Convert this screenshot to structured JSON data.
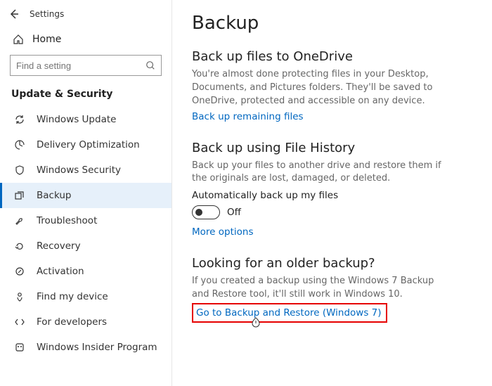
{
  "app": {
    "title": "Settings"
  },
  "home": {
    "label": "Home"
  },
  "search": {
    "placeholder": "Find a setting"
  },
  "section_header": "Update & Security",
  "nav": [
    {
      "key": "windows-update",
      "label": "Windows Update"
    },
    {
      "key": "delivery-optimization",
      "label": "Delivery Optimization"
    },
    {
      "key": "windows-security",
      "label": "Windows Security"
    },
    {
      "key": "backup",
      "label": "Backup",
      "selected": true
    },
    {
      "key": "troubleshoot",
      "label": "Troubleshoot"
    },
    {
      "key": "recovery",
      "label": "Recovery"
    },
    {
      "key": "activation",
      "label": "Activation"
    },
    {
      "key": "find-my-device",
      "label": "Find my device"
    },
    {
      "key": "for-developers",
      "label": "For developers"
    },
    {
      "key": "windows-insider",
      "label": "Windows Insider Program"
    }
  ],
  "page": {
    "title": "Backup",
    "onedrive": {
      "heading": "Back up files to OneDrive",
      "desc": "You're almost done protecting files in your Desktop, Documents, and Pictures folders. They'll be saved to OneDrive, protected and accessible on any device.",
      "link": "Back up remaining files"
    },
    "file_history": {
      "heading": "Back up using File History",
      "desc": "Back up your files to another drive and restore them if the originals are lost, damaged, or deleted.",
      "toggle_label": "Automatically back up my files",
      "toggle_state": "Off",
      "more_options": "More options"
    },
    "older": {
      "heading": "Looking for an older backup?",
      "desc": "If you created a backup using the Windows 7 Backup and Restore tool, it'll still work in Windows 10.",
      "link": "Go to Backup and Restore (Windows 7)"
    }
  }
}
